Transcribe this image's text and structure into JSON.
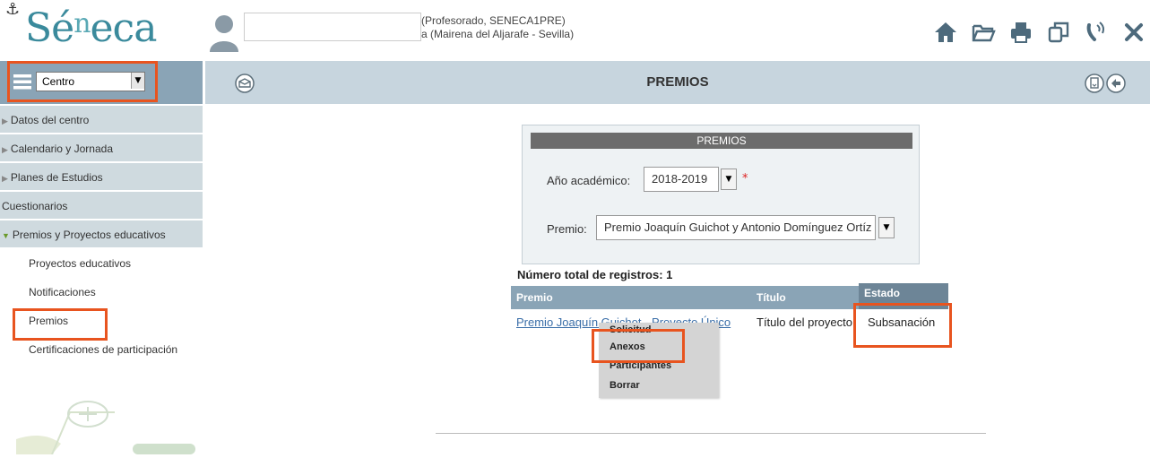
{
  "header": {
    "logo_anchor": "⚓",
    "logo_prefix": "Sé",
    "logo_sup": "n",
    "logo_suffix": "eca",
    "user_line1": "(Profesorado, SENECA1PRE)",
    "user_line2": "a (Mairena del Aljarafe - Sevilla)",
    "icons": [
      "home-icon",
      "folder-icon",
      "print-icon",
      "windows-icon",
      "phone-icon",
      "close-icon"
    ]
  },
  "leftbar": {
    "selector_value": "Centro"
  },
  "title": "PREMIOS",
  "sidebar": {
    "items": [
      {
        "label": "Datos del centro",
        "type": "group"
      },
      {
        "label": "Calendario y Jornada",
        "type": "group"
      },
      {
        "label": "Planes de Estudios",
        "type": "group"
      },
      {
        "label": "Cuestionarios",
        "type": "group"
      },
      {
        "label": "Premios y Proyectos educativos",
        "type": "group-open"
      },
      {
        "label": "Proyectos educativos",
        "type": "sub"
      },
      {
        "label": "Notificaciones",
        "type": "sub"
      },
      {
        "label": "Premios",
        "type": "sub"
      },
      {
        "label": "Certificaciones de participación",
        "type": "sub"
      }
    ]
  },
  "form": {
    "header": "PREMIOS",
    "ano_label": "Año académico:",
    "ano_value": "2018-2019",
    "required_mark": "*",
    "premio_label": "Premio:",
    "premio_value": "Premio Joaquín Guichot y Antonio Domínguez Ortíz"
  },
  "results": {
    "total_label": "Número total de registros: 1",
    "columns": [
      "Premio",
      "Título",
      "Estado"
    ],
    "rows": [
      {
        "premio": "Premio Joaquín Guichot - Proyecto Único",
        "titulo": "Título del proyecto",
        "estado": "Subsanación"
      }
    ]
  },
  "context_menu": {
    "items": [
      "Solicitud",
      "Anexos",
      "Participantes",
      "Borrar"
    ]
  },
  "colors": {
    "accent_highlight": "#e8541f",
    "bar_blue": "#8aa4b6",
    "title_bar": "#c7d5de",
    "link": "#3a6ea8"
  }
}
